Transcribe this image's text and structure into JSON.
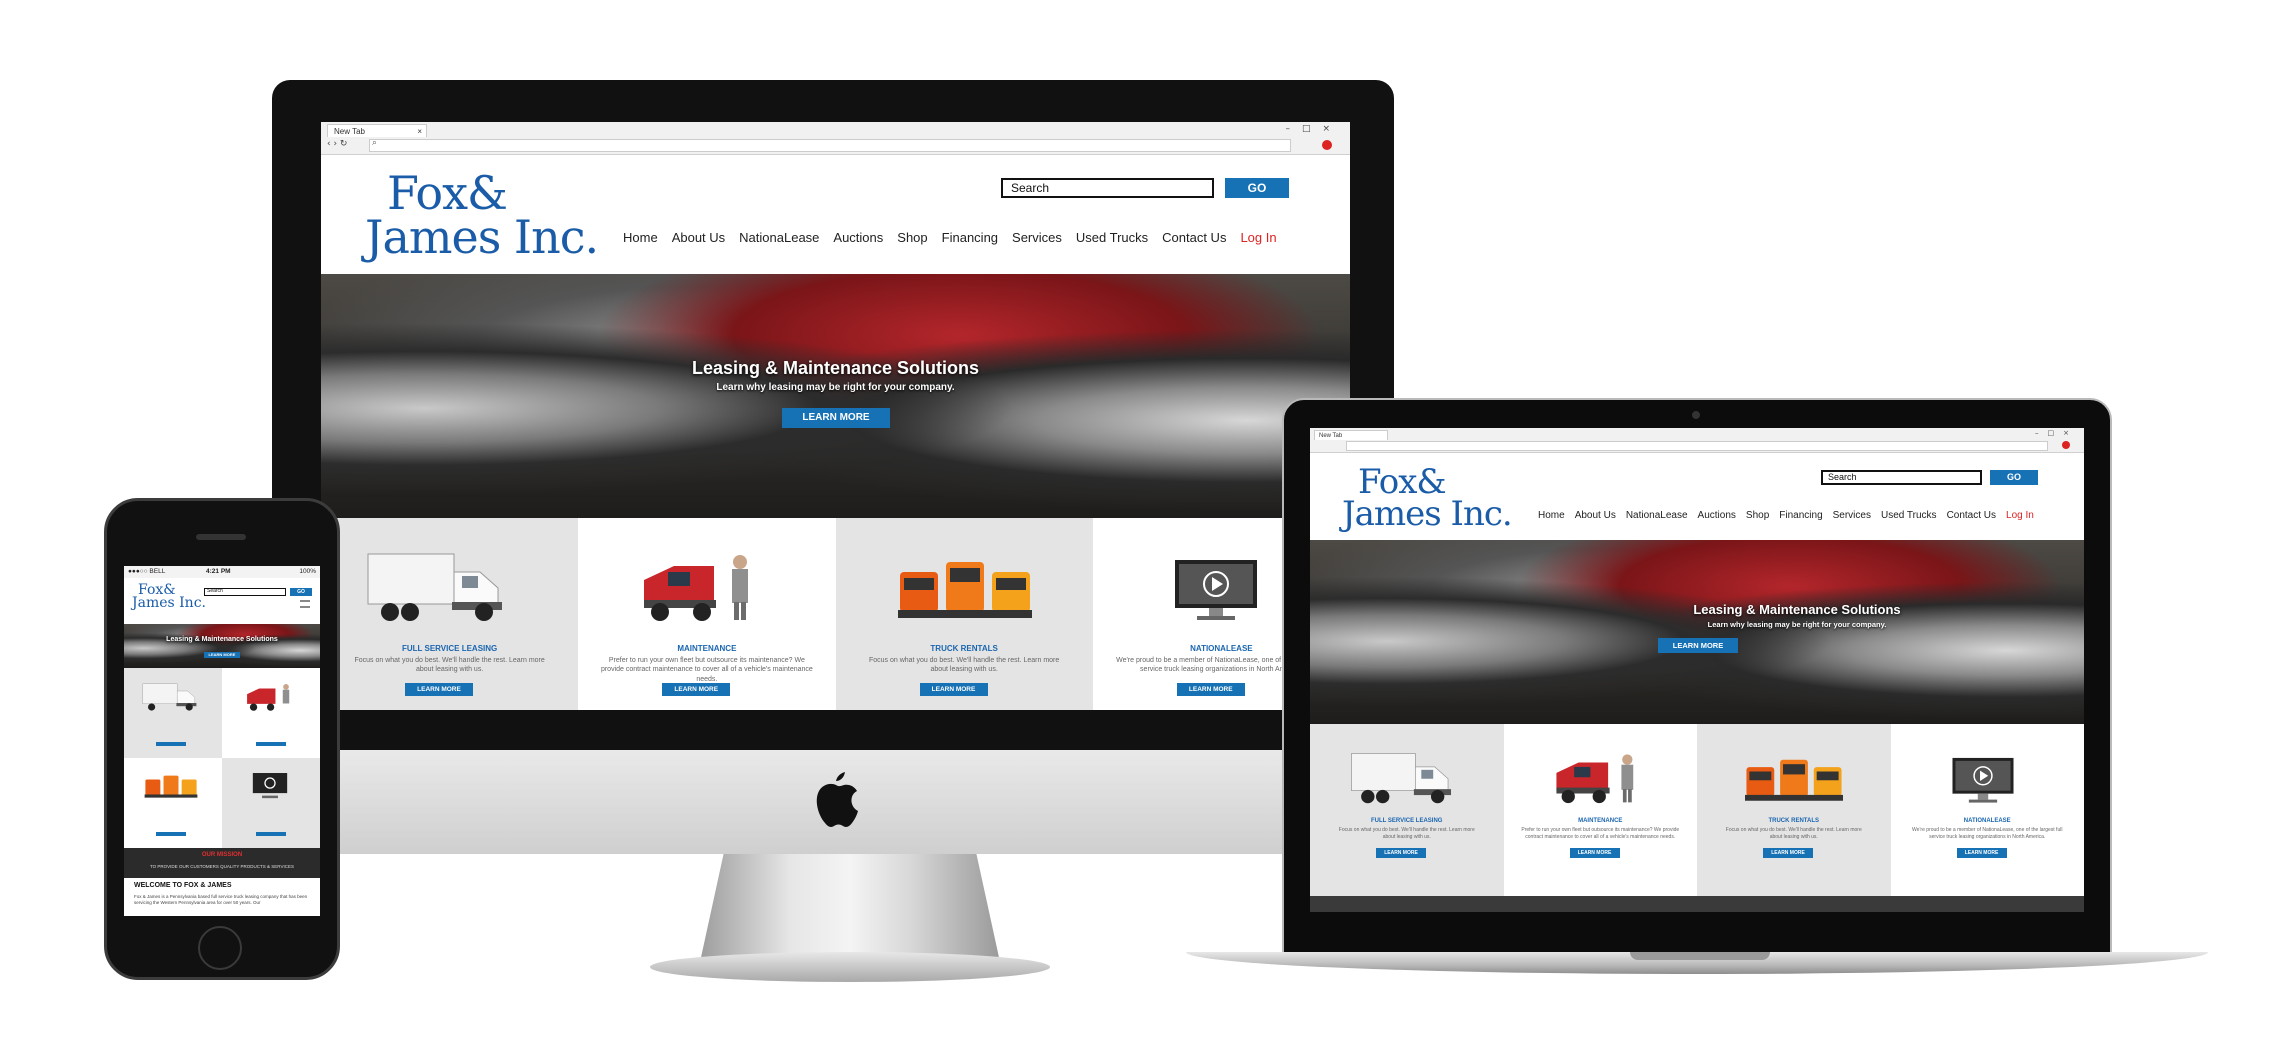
{
  "browser": {
    "tab_label": "New Tab",
    "address_icon": "search-icon",
    "window_controls": [
      "–",
      "□",
      "×"
    ]
  },
  "header": {
    "logo_line1": "Fox&",
    "logo_line2": "James Inc.",
    "search_placeholder": "Search",
    "go_label": "GO",
    "nav": [
      "Home",
      "About Us",
      "NationaLease",
      "Auctions",
      "Shop",
      "Financing",
      "Services",
      "Used Trucks",
      "Contact Us"
    ],
    "login": "Log In"
  },
  "hero": {
    "title": "Leasing & Maintenance Solutions",
    "subtitle": "Learn why leasing may be right for your company.",
    "button": "LEARN MORE"
  },
  "cards": [
    {
      "title": "FULL SERVICE LEASING",
      "text": "Focus on what you do best. We'll handle the rest. Learn more about leasing with us.",
      "button": "LEARN MORE",
      "image": "box-truck"
    },
    {
      "title": "MAINTENANCE",
      "text": "Prefer to run your own fleet but outsource its maintenance? We provide contract maintenance to cover all of a vehicle's maintenance needs.",
      "button": "LEARN MORE",
      "image": "red-truck-with-person"
    },
    {
      "title": "TRUCK RENTALS",
      "text": "Focus on what you do best. We'll handle the rest. Learn more about leasing with us.",
      "button": "LEARN MORE",
      "image": "orange-trucks"
    },
    {
      "title": "NATIONALEASE",
      "text": "We're proud to be a member of NationaLease, one of the largest full service truck leasing organizations in North America.",
      "button": "LEARN MORE",
      "image": "video-monitor"
    }
  ],
  "phone": {
    "status_carrier": "●●●○○ BELL",
    "status_time": "4:21 PM",
    "status_battery": "100%",
    "mission_title": "OUR MISSION",
    "mission_text": "TO PROVIDE OUR CUSTOMERS QUALITY PRODUCTS & SERVICES",
    "welcome_title": "WELCOME TO FOX & JAMES",
    "welcome_text": "Fox & James is a Pennsylvania based full service truck leasing company that has been servicing the Western Pennsylvania area for over 50 years. Our"
  },
  "colors": {
    "brand_blue": "#1671b5",
    "logo_blue": "#1a5ca8",
    "login_red": "#dd2222",
    "card_grey": "#e4e4e4"
  }
}
